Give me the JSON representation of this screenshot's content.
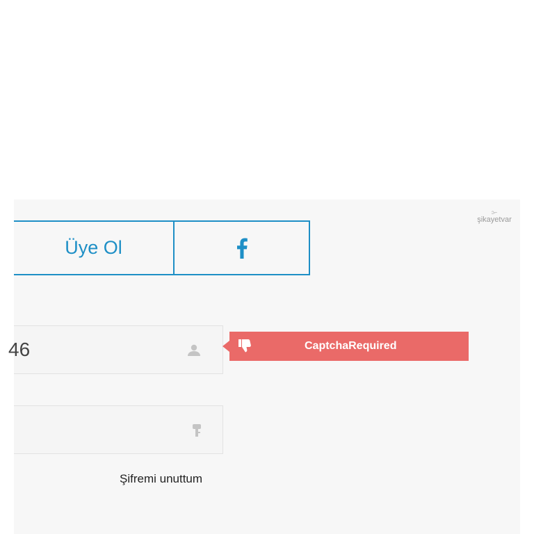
{
  "brand": {
    "name": "şikayetvar"
  },
  "buttons": {
    "signup_label": "Üye Ol",
    "facebook_icon": "f"
  },
  "fields": {
    "username_value": "46",
    "username_icon": "user-icon",
    "password_value": "",
    "password_icon": "key-icon"
  },
  "alert": {
    "message": "CaptchaRequired",
    "icon": "thumbs-down-icon",
    "color": "#ea6a68"
  },
  "links": {
    "forgot_password": "Şifremi unuttum"
  },
  "colors": {
    "accent": "#1e8fc6",
    "panel": "#f7f7f7"
  }
}
